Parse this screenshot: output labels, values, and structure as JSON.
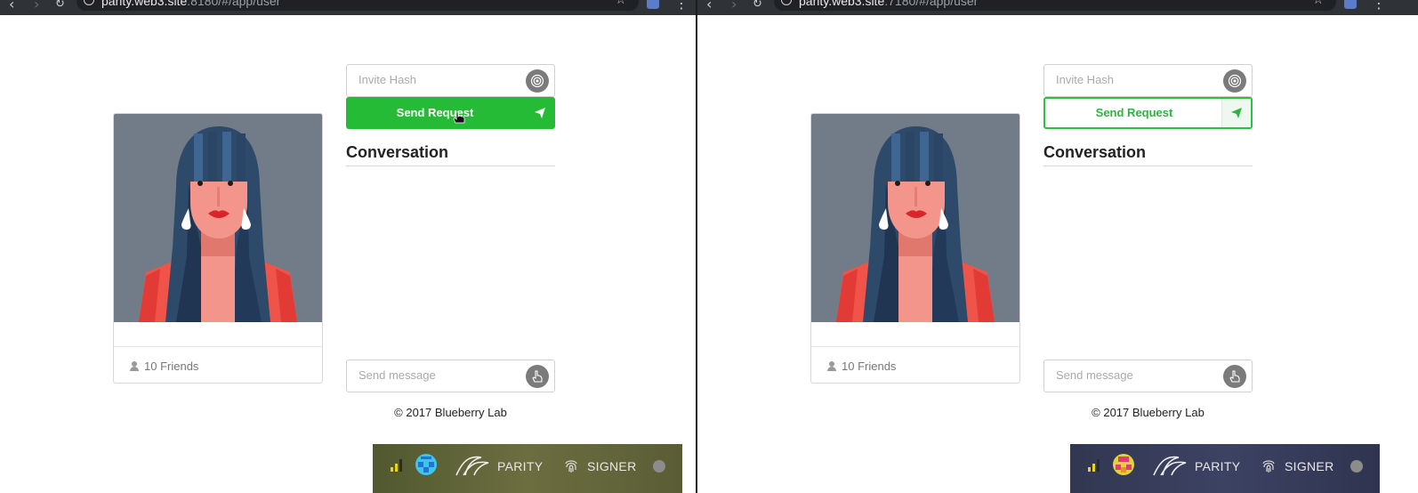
{
  "browser": {
    "left": {
      "url_host": "parity.web3.site",
      "url_path": ":8180/#/app/user"
    },
    "right": {
      "url_host": "parity.web3.site",
      "url_path": ":7180/#/app/user"
    }
  },
  "profile": {
    "friends_label": "10 Friends"
  },
  "invite": {
    "placeholder": "Invite Hash"
  },
  "send_request": {
    "label": "Send Request"
  },
  "conversation": {
    "title": "Conversation"
  },
  "message": {
    "placeholder": "Send message"
  },
  "footer": {
    "copyright": "© 2017 Blueberry Lab"
  },
  "parity_bar": {
    "parity_label": "PARITY",
    "signer_label": "SIGNER",
    "left_bg": "#5f6338",
    "right_bg": "#363b59"
  },
  "colors": {
    "accent_green": "#25bb37"
  }
}
